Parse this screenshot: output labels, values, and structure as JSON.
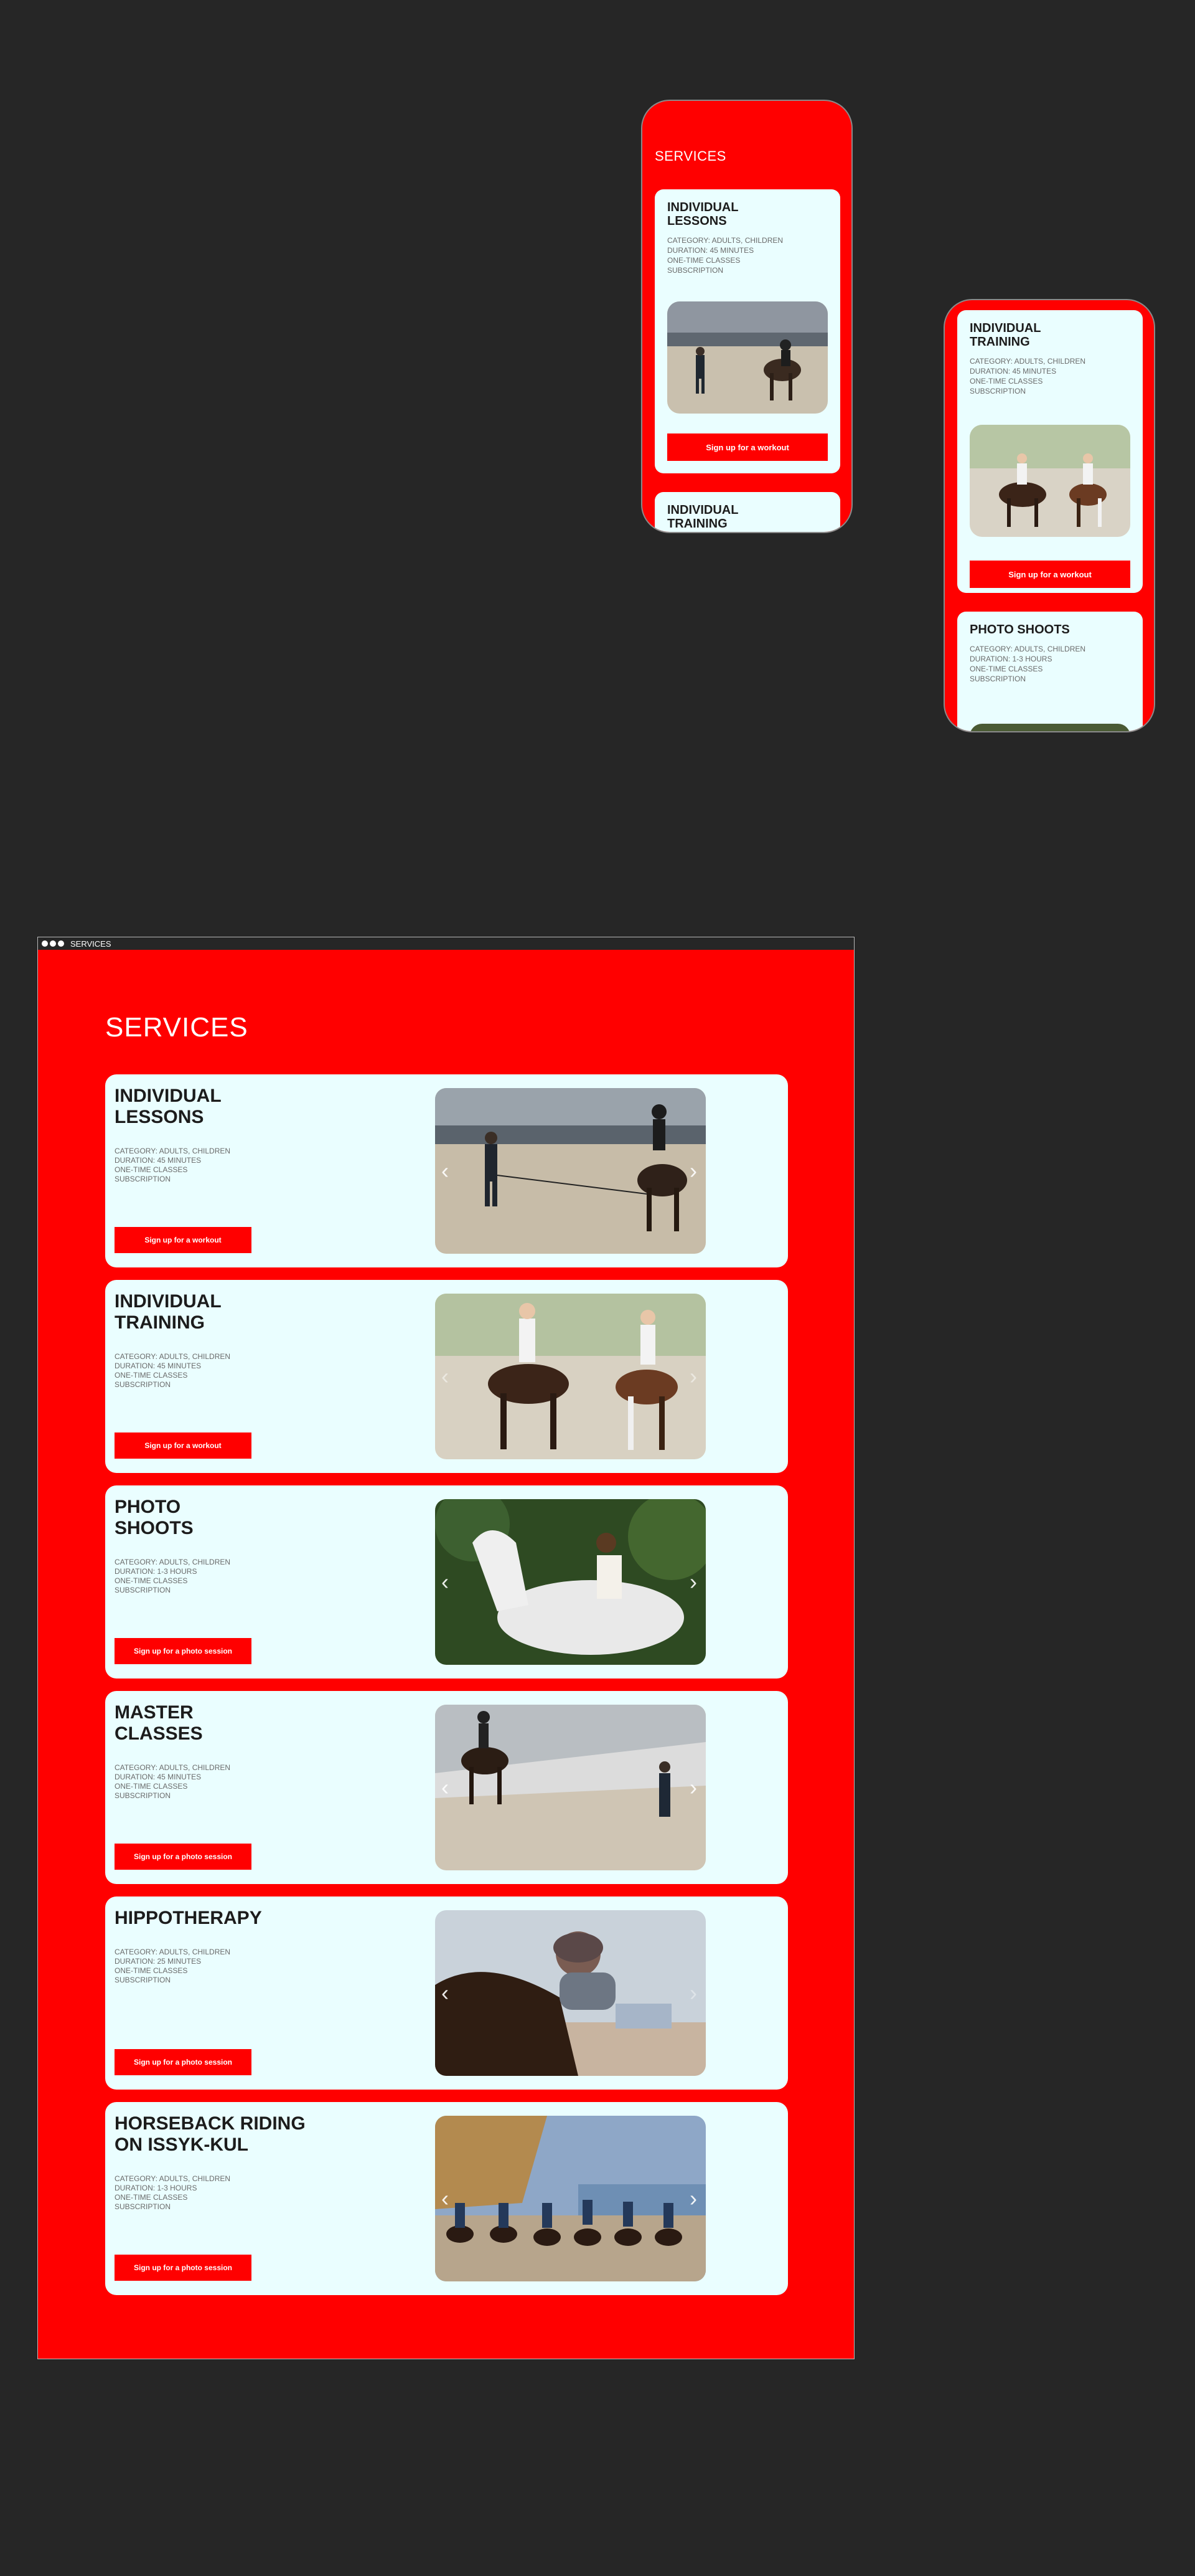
{
  "mobile_1": {
    "title": "SERVICES",
    "cards": [
      {
        "title": "INDIVIDUAL LESSONS",
        "meta": [
          "CATEGORY: ADULTS, CHILDREN",
          "DURATION: 45 MINUTES",
          "ONE-TIME CLASSES",
          "SUBSCRIPTION"
        ],
        "button": "Sign up for a workout"
      },
      {
        "title": "INDIVIDUAL TRAINING"
      }
    ]
  },
  "mobile_2": {
    "cards": [
      {
        "title": "INDIVIDUAL TRAINING",
        "meta": [
          "CATEGORY: ADULTS, CHILDREN",
          "DURATION: 45 MINUTES",
          "ONE-TIME CLASSES",
          "SUBSCRIPTION"
        ],
        "button": "Sign up for a workout"
      },
      {
        "title": "PHOTO SHOOTS",
        "meta": [
          "CATEGORY: ADULTS, CHILDREN",
          "DURATION: 1-3 HOURS",
          "ONE-TIME CLASSES",
          "SUBSCRIPTION"
        ]
      }
    ]
  },
  "desktop": {
    "window_title": "SERVICES",
    "title": "SERVICES",
    "cards": [
      {
        "title": "INDIVIDUAL LESSONS",
        "meta": [
          "CATEGORY: ADULTS, CHILDREN",
          "DURATION: 45 MINUTES",
          "ONE-TIME CLASSES",
          "SUBSCRIPTION"
        ],
        "button": "Sign up for a workout"
      },
      {
        "title": "INDIVIDUAL TRAINING",
        "meta": [
          "CATEGORY: ADULTS, CHILDREN",
          "DURATION: 45 MINUTES",
          "ONE-TIME CLASSES",
          "SUBSCRIPTION"
        ],
        "button": "Sign up for a workout"
      },
      {
        "title": "PHOTO SHOOTS",
        "meta": [
          "CATEGORY: ADULTS, CHILDREN",
          "DURATION: 1-3 HOURS",
          "ONE-TIME CLASSES",
          "SUBSCRIPTION"
        ],
        "button": "Sign up for a photo session"
      },
      {
        "title": "MASTER CLASSES",
        "meta": [
          "CATEGORY: ADULTS, CHILDREN",
          "DURATION: 45 MINUTES",
          "ONE-TIME CLASSES",
          "SUBSCRIPTION"
        ],
        "button": "Sign up for a photo session"
      },
      {
        "title": "HIPPOTHERAPY",
        "meta": [
          "CATEGORY: ADULTS, CHILDREN",
          "DURATION: 25 MINUTES",
          "ONE-TIME CLASSES",
          "SUBSCRIPTION"
        ],
        "button": "Sign up for a photo session"
      },
      {
        "title": "HORSEBACK RIDING ON ISSYK-KUL",
        "meta": [
          "CATEGORY: ADULTS, CHILDREN",
          "DURATION: 1-3 HOURS",
          "ONE-TIME CLASSES",
          "SUBSCRIPTION"
        ],
        "button": "Sign up for a photo session"
      }
    ]
  },
  "icons": {
    "prev": "chevron-left-icon",
    "next": "chevron-right-icon"
  },
  "colors": {
    "brand_red": "#ff0000",
    "card_bg": "#eafeff",
    "canvas": "#262626"
  }
}
